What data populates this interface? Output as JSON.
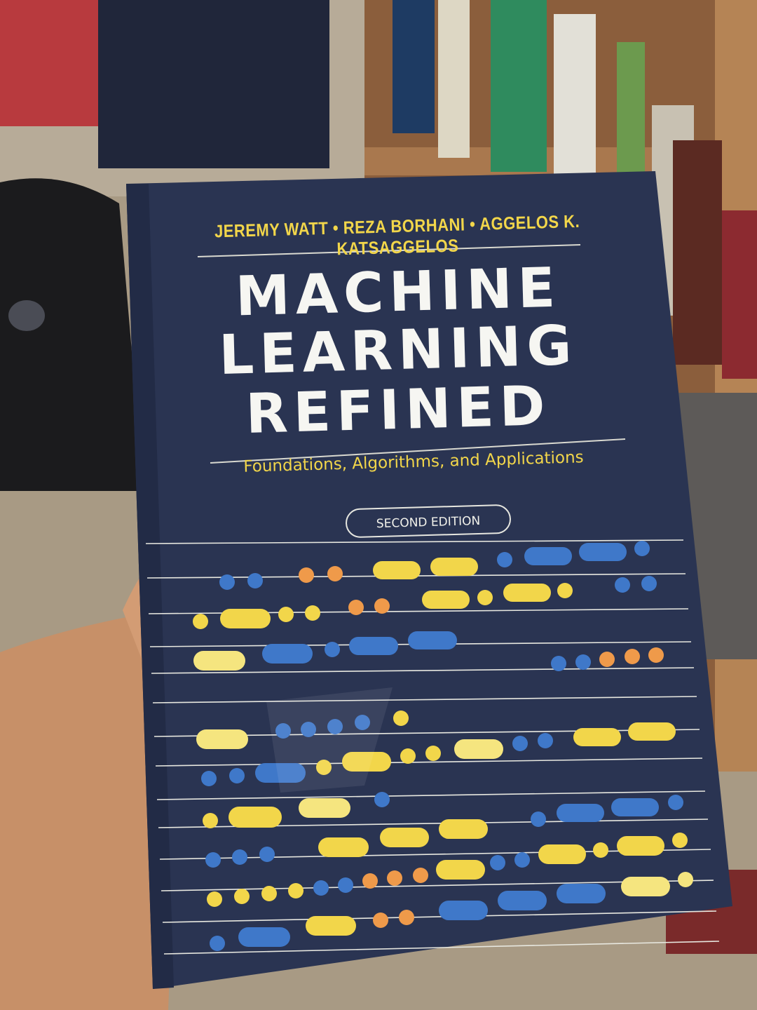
{
  "book": {
    "authors": "JEREMY WATT • REZA BORHANI • AGGELOS K. KATSAGGELOS",
    "title_line_1": "MACHINE",
    "title_line_2": "LEARNING",
    "title_line_3": "REFINED",
    "subtitle": "Foundations, Algorithms, and Applications",
    "edition": "SECOND EDITION"
  },
  "colors": {
    "cover_navy": "#2a3452",
    "accent_yellow": "#f2d64a",
    "accent_blue": "#3f78c9",
    "accent_orange": "#ef9a4a"
  }
}
